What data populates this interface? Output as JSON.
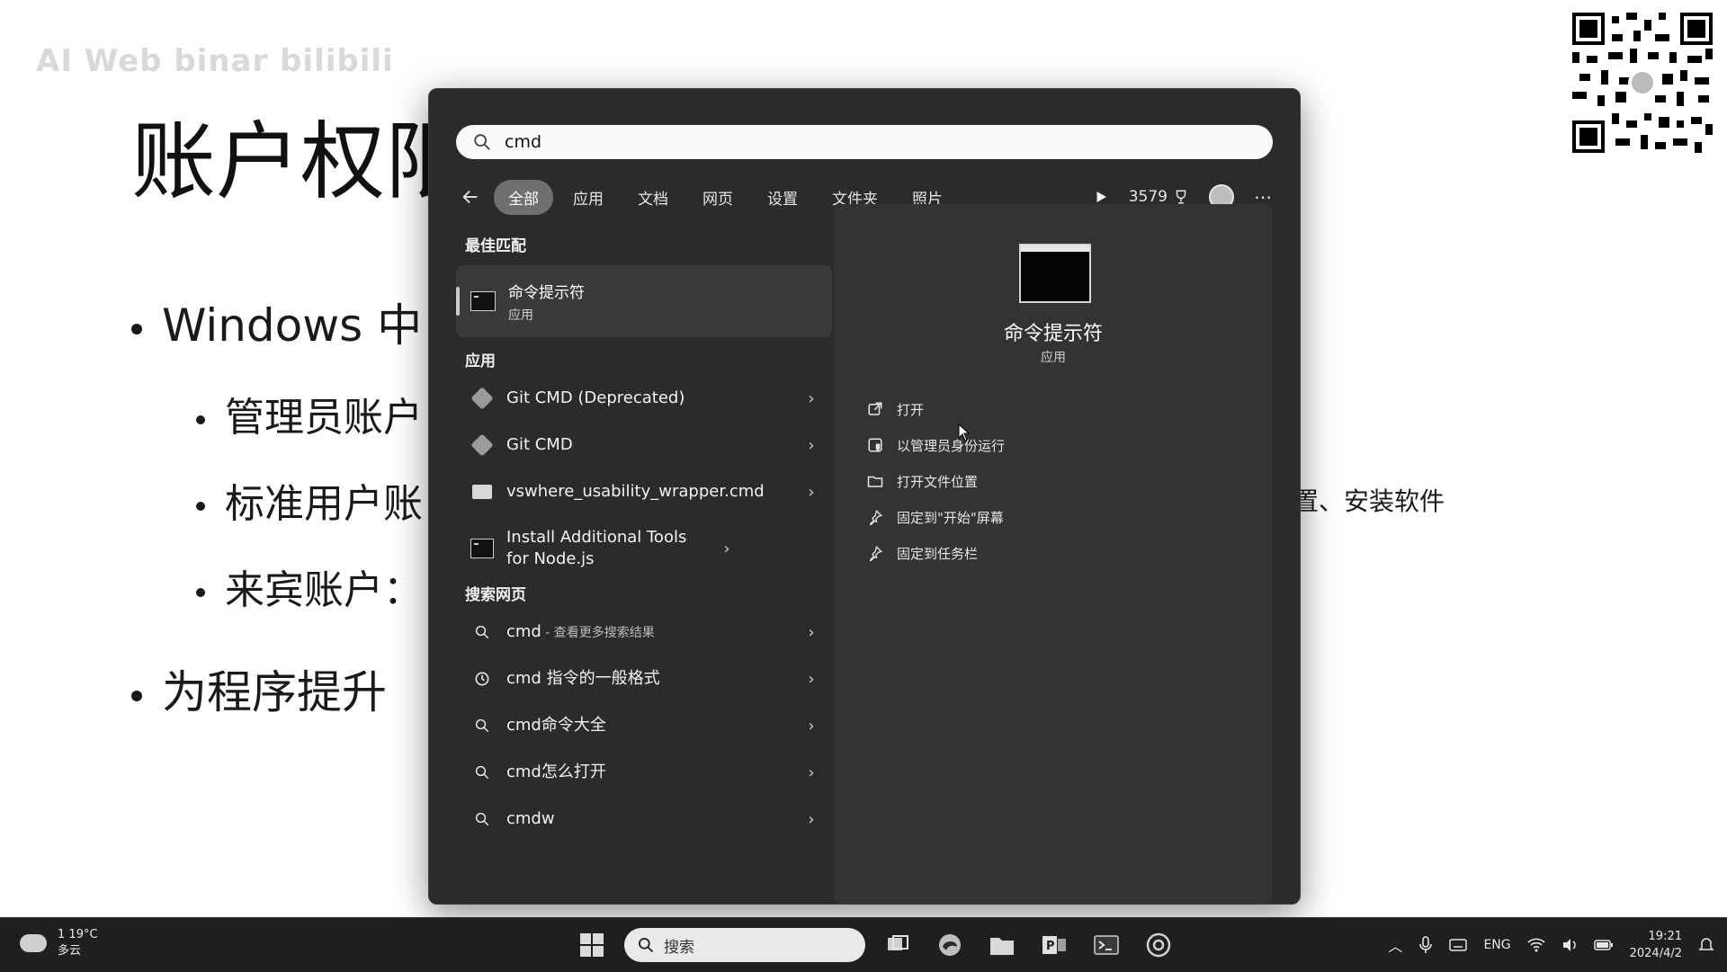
{
  "slide": {
    "watermark": "AI Web binar bilibili",
    "title": "账户权限",
    "bullets_l1": [
      "Windows 中",
      "为程序提升"
    ],
    "bullets_l2": [
      "管理员账户",
      "标准用户账",
      "来宾账户："
    ],
    "right_fragment": "置、安装软件"
  },
  "search": {
    "query": "cmd"
  },
  "filters": {
    "tabs": [
      "全部",
      "应用",
      "文档",
      "网页",
      "设置",
      "文件夹",
      "照片"
    ],
    "active_index": 0,
    "points": "3579"
  },
  "best_match": {
    "heading": "最佳匹配",
    "title": "命令提示符",
    "subtitle": "应用"
  },
  "apps": {
    "heading": "应用",
    "items": [
      {
        "label": "Git CMD (Deprecated)",
        "icon": "git-icon"
      },
      {
        "label": "Git CMD",
        "icon": "git-icon"
      },
      {
        "label": "vswhere_usability_wrapper.cmd",
        "icon": "image-file-icon"
      },
      {
        "label": "Install Additional Tools for Node.js",
        "icon": "cmd-app-icon"
      }
    ]
  },
  "web": {
    "heading": "搜索网页",
    "items": [
      {
        "label": "cmd",
        "suffix": " - 查看更多搜索结果",
        "icon": "search-icon"
      },
      {
        "label": "cmd 指令的一般格式",
        "suffix": "",
        "icon": "history-icon"
      },
      {
        "label": "cmd命令大全",
        "suffix": "",
        "icon": "search-icon"
      },
      {
        "label": "cmd怎么打开",
        "suffix": "",
        "icon": "search-icon"
      },
      {
        "label": "cmdw",
        "suffix": "",
        "icon": "search-icon"
      }
    ]
  },
  "preview": {
    "title": "命令提示符",
    "subtitle": "应用",
    "actions": [
      {
        "label": "打开",
        "icon": "open-external-icon"
      },
      {
        "label": "以管理员身份运行",
        "icon": "shield-run-icon"
      },
      {
        "label": "打开文件位置",
        "icon": "folder-icon"
      },
      {
        "label": "固定到\"开始\"屏幕",
        "icon": "pin-icon"
      },
      {
        "label": "固定到任务栏",
        "icon": "pin-icon"
      }
    ]
  },
  "taskbar": {
    "weather_badge": "1",
    "temperature": "19°C",
    "condition": "多云",
    "search_placeholder": "搜索",
    "language": "ENG",
    "time": "19:21",
    "date": "2024/4/2"
  }
}
